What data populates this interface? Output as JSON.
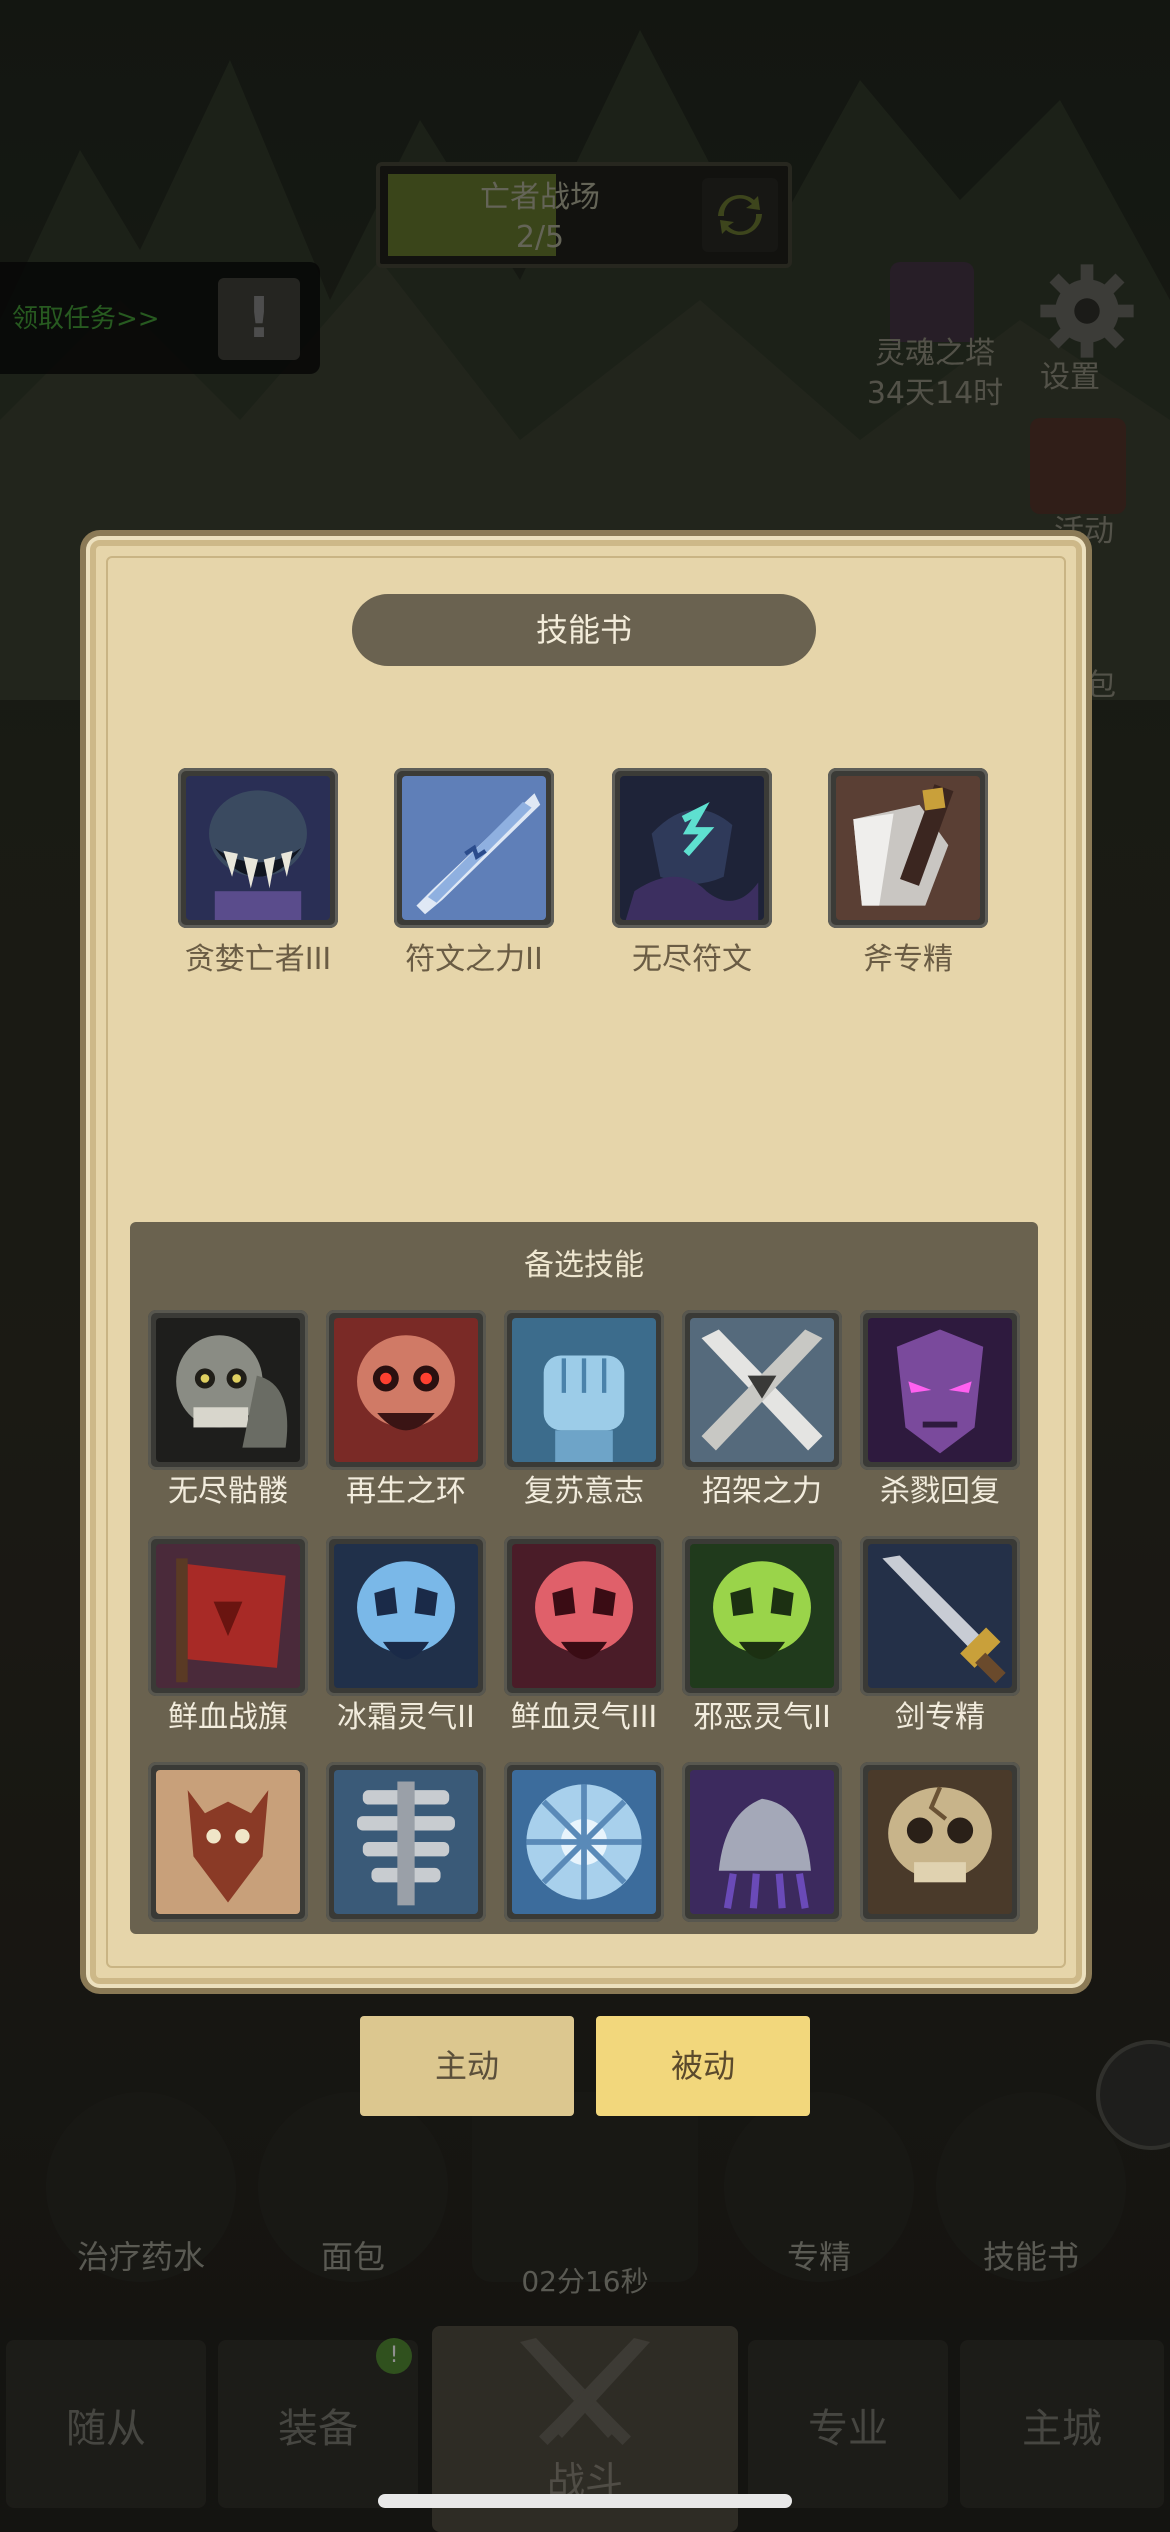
{
  "stage": {
    "name": "亡者战场",
    "progress": "2/5"
  },
  "quest": {
    "label": "领取任务>>",
    "mark": "!"
  },
  "side_menu": {
    "tower_label": "灵魂之塔",
    "tower_timer": "34天14时",
    "settings_label": "设置",
    "event_label": "活动",
    "bag_label": "包"
  },
  "dialog": {
    "title": "技能书",
    "equipped": [
      {
        "name": "贪婪亡者III",
        "icon": "ghoul-maw-icon"
      },
      {
        "name": "符文之力II",
        "icon": "rune-blade-icon"
      },
      {
        "name": "无尽符文",
        "icon": "rune-gauntlet-icon"
      },
      {
        "name": "斧专精",
        "icon": "axe-icon"
      }
    ],
    "reserve_title": "备选技能",
    "reserve": [
      {
        "name": "无尽骷髅",
        "icon": "skeleton-icon"
      },
      {
        "name": "再生之环",
        "icon": "red-skull-icon"
      },
      {
        "name": "复苏意志",
        "icon": "fist-icon"
      },
      {
        "name": "招架之力",
        "icon": "crossed-blades-icon"
      },
      {
        "name": "杀戮回复",
        "icon": "purple-demon-icon"
      },
      {
        "name": "鲜血战旗",
        "icon": "blood-banner-icon"
      },
      {
        "name": "冰霜灵气II",
        "icon": "frost-skull-icon"
      },
      {
        "name": "鲜血灵气III",
        "icon": "blood-skull-icon"
      },
      {
        "name": "邪恶灵气II",
        "icon": "unholy-skull-icon"
      },
      {
        "name": "剑专精",
        "icon": "sword-icon"
      },
      {
        "name": "",
        "icon": "horned-mask-icon"
      },
      {
        "name": "",
        "icon": "spine-icon"
      },
      {
        "name": "",
        "icon": "ice-shield-icon"
      },
      {
        "name": "",
        "icon": "claw-icon"
      },
      {
        "name": "",
        "icon": "cracked-skull-icon"
      }
    ]
  },
  "mode_tabs": {
    "active": "主动",
    "passive": "被动"
  },
  "consumables": [
    {
      "label": "治疗药水"
    },
    {
      "label": "面包"
    },
    {
      "label": "专精"
    },
    {
      "label": "技能书"
    }
  ],
  "chest_timer": "02分16秒",
  "bottom_nav": {
    "followers": "随从",
    "equipment": "装备",
    "battle": "战斗",
    "profession": "专业",
    "city": "主城",
    "equipment_badge": "!"
  },
  "colors": {
    "dialog_bg": "#e6d5aa",
    "panel_bg": "#6a624f",
    "passive_tab": "#f2d77c"
  }
}
